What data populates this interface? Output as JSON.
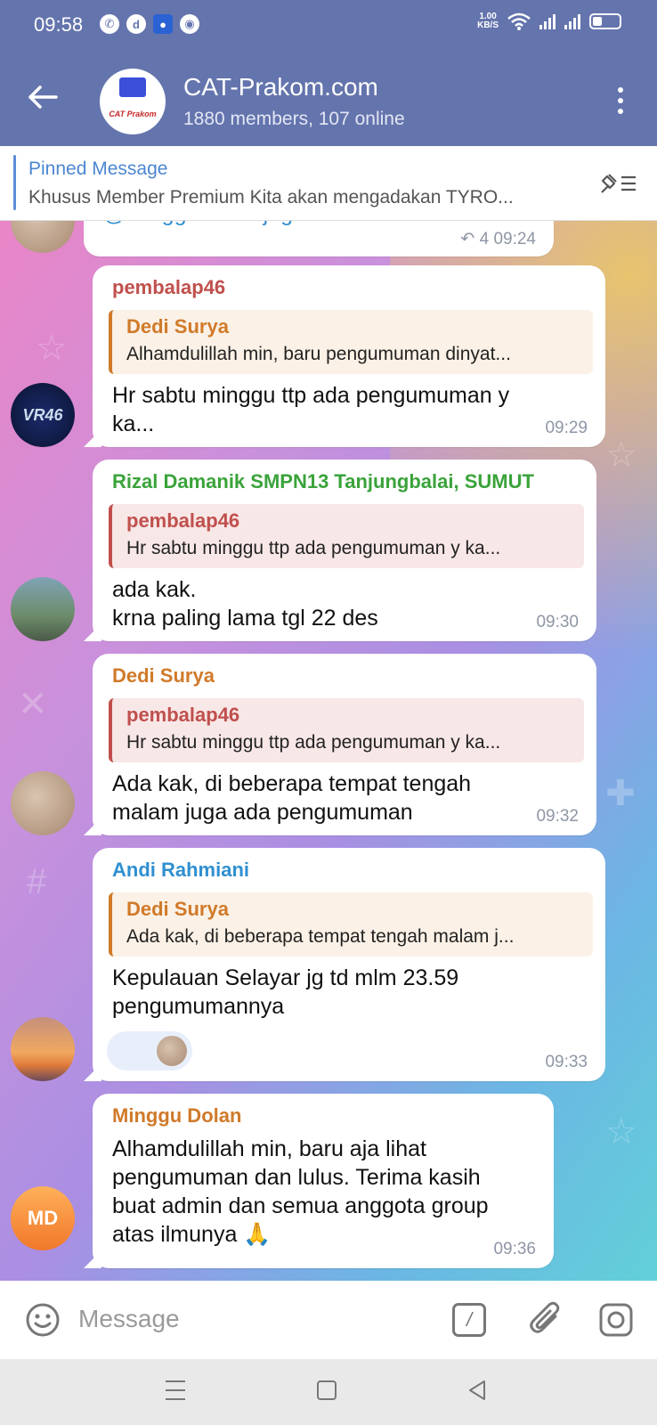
{
  "status_bar": {
    "time": "09:58",
    "net_speed_value": "1.00",
    "net_speed_unit": "KB/S"
  },
  "header": {
    "title": "CAT-Prakom.com",
    "subtitle": "1880 members, 107 online",
    "avatar_text": "CAT Prakom"
  },
  "pinned": {
    "label": "Pinned Message",
    "text": "Khusus Member Premium Kita akan mengadakan TYRO..."
  },
  "messages": [
    {
      "body": "@MingguDolan juga lulus min",
      "replies_count": "4",
      "time": "09:24"
    },
    {
      "sender": "pembalap46",
      "reply_name": "Dedi Surya",
      "reply_text": "Alhamdulillah min, baru pengumuman dinyat...",
      "body_line1": "Hr sabtu minggu ttp ada pengumuman y",
      "body_line2": "ka...",
      "time": "09:29",
      "avatar_text": "VR46"
    },
    {
      "sender": "Rizal Damanik SMPN13 Tanjungbalai, SUMUT",
      "reply_name": "pembalap46",
      "reply_text": "Hr sabtu minggu ttp ada pengumuman y ka...",
      "body_line1": "ada kak.",
      "body_line2": "krna paling lama tgl 22 des",
      "time": "09:30"
    },
    {
      "sender": "Dedi Surya",
      "reply_name": "pembalap46",
      "reply_text": "Hr sabtu minggu ttp ada pengumuman y ka...",
      "body_line1": "Ada kak, di beberapa tempat tengah",
      "body_line2": "malam juga ada pengumuman",
      "time": "09:32"
    },
    {
      "sender": "Andi Rahmiani",
      "reply_name": "Dedi Surya",
      "reply_text": "Ada kak, di beberapa tempat tengah malam j...",
      "body_line1": "Kepulauan Selayar jg td mlm 23.59",
      "body_line2": "pengumumannya",
      "time": "09:33"
    },
    {
      "sender": "Minggu Dolan",
      "body_line1": "Alhamdulillah min, baru aja lihat",
      "body_line2": "pengumuman dan lulus. Terima kasih",
      "body_line3": "buat admin dan semua anggota group",
      "body_line4": "atas ilmunya 🙏",
      "time": "09:36",
      "avatar_initials": "MD"
    }
  ],
  "input": {
    "placeholder": "Message"
  },
  "colors": {
    "header": "#6474ad",
    "pinned_label": "#4c86d0",
    "sender_red": "#c0504d",
    "sender_green": "#3aa33a",
    "sender_orange": "#d07a2a",
    "sender_blue": "#2f8fd0"
  },
  "icons": [
    "back-arrow-icon",
    "more-vertical-icon",
    "unpin-icon",
    "emoji-icon",
    "bot-command-icon",
    "attach-icon",
    "camera-icon",
    "nav-menu-icon",
    "nav-home-icon",
    "nav-back-icon"
  ]
}
